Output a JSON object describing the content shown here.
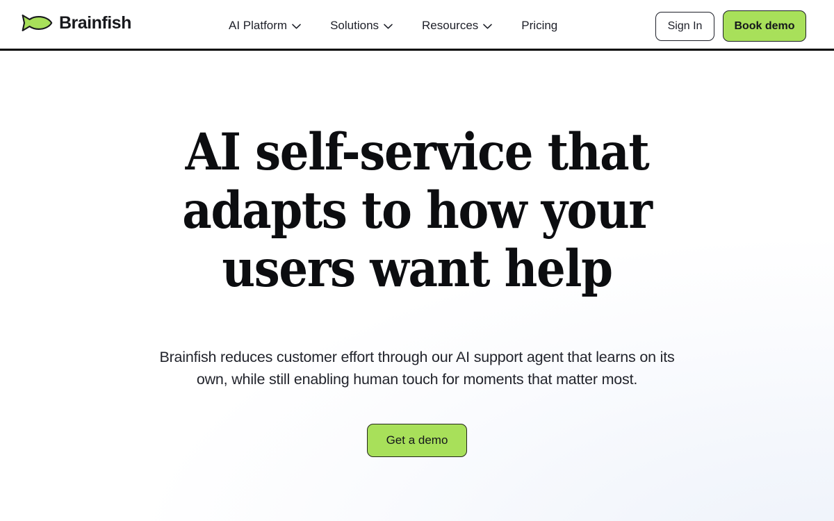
{
  "brand": {
    "name": "Brainfish",
    "logo_icon": "fish-icon",
    "accent_color": "#a8e05a",
    "text_color": "#17181c"
  },
  "header": {
    "nav": [
      {
        "label": "AI Platform",
        "has_dropdown": true,
        "icon": "chevron-down-icon"
      },
      {
        "label": "Solutions",
        "has_dropdown": true,
        "icon": "chevron-down-icon"
      },
      {
        "label": "Resources",
        "has_dropdown": true,
        "icon": "chevron-down-icon"
      },
      {
        "label": "Pricing",
        "has_dropdown": false,
        "icon": ""
      }
    ],
    "sign_in_label": "Sign In",
    "book_demo_label": "Book demo"
  },
  "hero": {
    "headline": "AI self-service that adapts to how your users want help",
    "subheadline": "Brainfish reduces customer effort through our AI support agent that learns on its own, while still enabling human touch for moments that matter most.",
    "cta_label": "Get a demo"
  }
}
